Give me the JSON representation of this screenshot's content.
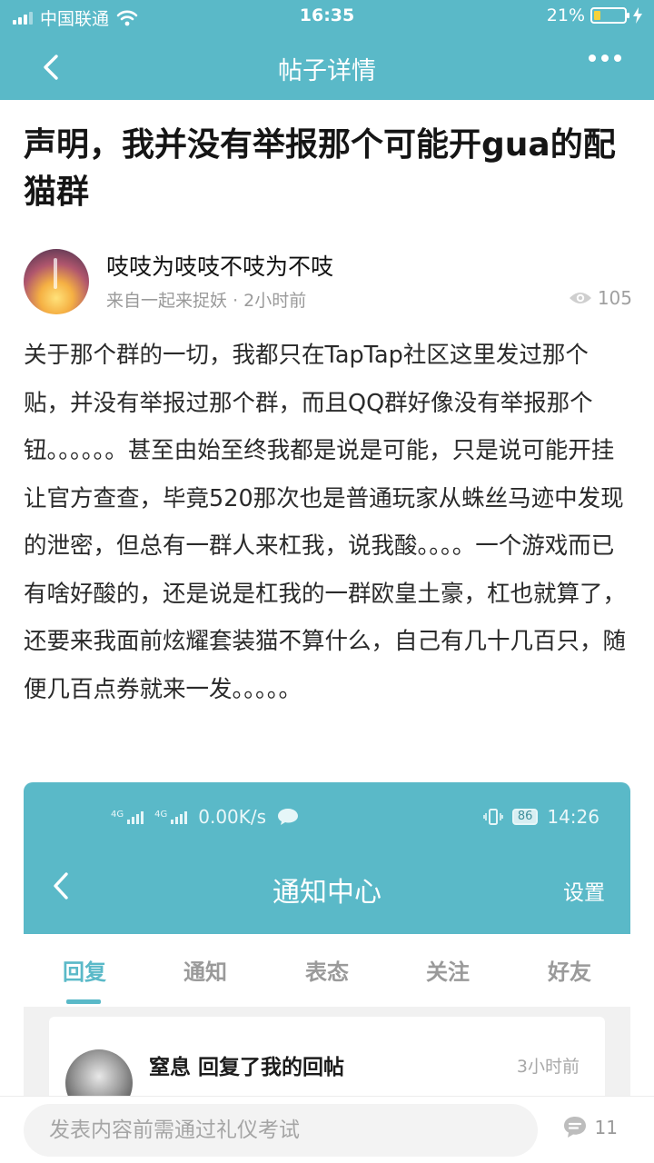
{
  "status_bar": {
    "carrier": "中国联通",
    "time": "16:35",
    "battery_percent": "21%",
    "battery_level": 0.21
  },
  "nav": {
    "title": "帖子详情"
  },
  "post": {
    "title": "声明，我并没有举报那个可能开gua的配猫群",
    "author_name": "吱吱为吱吱不吱为不吱",
    "source": "来自一起来捉妖",
    "time_ago": "2小时前",
    "views": "105",
    "body": "关于那个群的一切，我都只在TapTap社区这里发过那个贴，并没有举报过那个群，而且QQ群好像没有举报那个钮。。。。。。甚至由始至终我都是说是可能，只是说可能开挂让官方查查，毕竟520那次也是普通玩家从蛛丝马迹中发现的泄密，但总有一群人来杠我，说我酸。。。。一个游戏而已有啥好酸的，还是说是杠我的一群欧皇土豪，杠也就算了，还要来我面前炫耀套装猫不算什么，自己有几十几百只，随便几百点券就来一发。。。。。"
  },
  "screenshot": {
    "network_speed": "0.00K/s",
    "signal_label": "4G",
    "battery": "86",
    "time": "14:26",
    "title": "通知中心",
    "settings": "设置",
    "tabs": [
      "回复",
      "通知",
      "表态",
      "关注",
      "好友"
    ],
    "active_tab": 0,
    "notification": {
      "who": "窒息 回复了我的回帖",
      "time_ago": "3小时前"
    }
  },
  "bottom": {
    "comment_placeholder": "发表内容前需通过礼仪考试",
    "comment_count": "11"
  },
  "colors": {
    "accent": "#5ab9c8"
  }
}
